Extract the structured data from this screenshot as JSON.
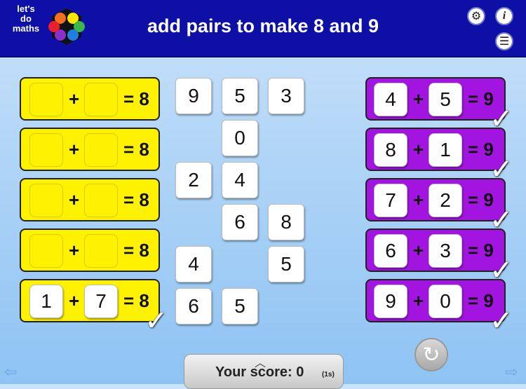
{
  "logo": {
    "lines": [
      "let's",
      "do",
      "maths"
    ]
  },
  "header": {
    "title": "add pairs to make 8 and 9"
  },
  "icons": {
    "settings": "gear-icon",
    "info": "i",
    "menu": "list-icon"
  },
  "left_rows": [
    {
      "a": "",
      "b": "",
      "result": "= 8",
      "complete": false
    },
    {
      "a": "",
      "b": "",
      "result": "= 8",
      "complete": false
    },
    {
      "a": "",
      "b": "",
      "result": "= 8",
      "complete": false
    },
    {
      "a": "",
      "b": "",
      "result": "= 8",
      "complete": false
    },
    {
      "a": "1",
      "b": "7",
      "result": "= 8",
      "complete": true
    }
  ],
  "right_rows": [
    {
      "a": "4",
      "b": "5",
      "result": "= 9",
      "complete": true
    },
    {
      "a": "8",
      "b": "1",
      "result": "= 9",
      "complete": true
    },
    {
      "a": "7",
      "b": "2",
      "result": "= 9",
      "complete": true
    },
    {
      "a": "6",
      "b": "3",
      "result": "= 9",
      "complete": true
    },
    {
      "a": "9",
      "b": "0",
      "result": "= 9",
      "complete": true
    }
  ],
  "plus_sign": "+",
  "tick": "✓",
  "tiles": [
    "9",
    "5",
    "3",
    "0",
    "2",
    "4",
    "6",
    "8",
    "4",
    "5",
    "6",
    "5"
  ],
  "score": {
    "label": "Your score: 0",
    "time": "(1s)"
  },
  "colors": {
    "header": "#0d0fa6",
    "yellow_row": "#fff200",
    "purple_row": "#a214e0"
  }
}
